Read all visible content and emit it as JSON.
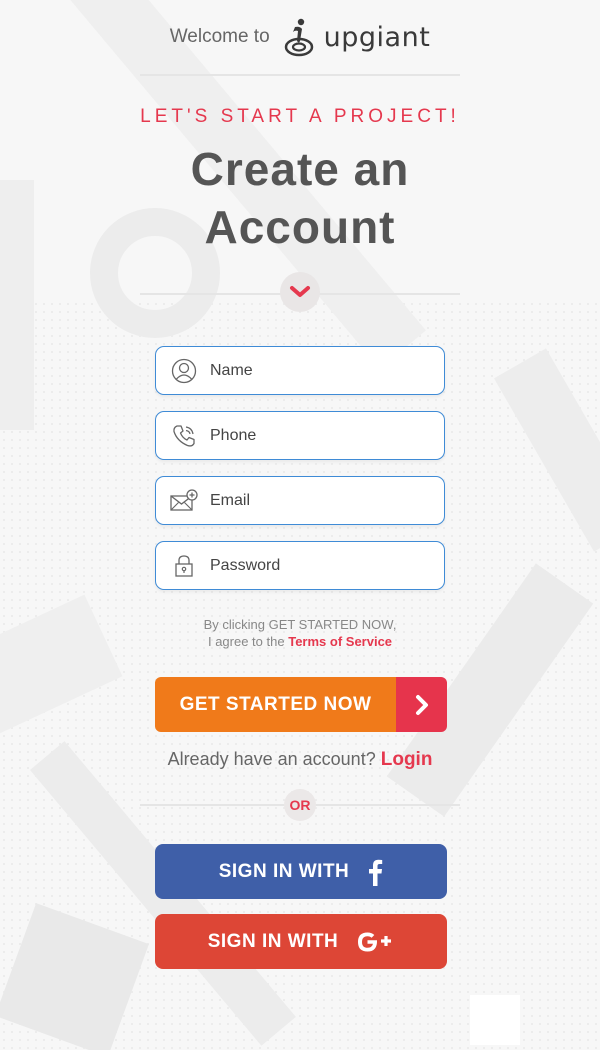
{
  "header": {
    "welcome_text": "Welcome to",
    "logo_text": "upgiant"
  },
  "hero": {
    "kicker": "LET'S START A PROJECT!",
    "title_line1": "Create an",
    "title_line2": "Account"
  },
  "form": {
    "name_placeholder": "Name",
    "phone_placeholder": "Phone",
    "email_placeholder": "Email",
    "password_placeholder": "Password"
  },
  "terms": {
    "line1": "By clicking GET STARTED NOW,",
    "line2": "I agree to the",
    "link": "Terms of Service"
  },
  "cta": {
    "label": "GET STARTED NOW"
  },
  "login": {
    "prompt": "Already have an account?",
    "link": "Login"
  },
  "or_label": "OR",
  "social": {
    "facebook_label": "SIGN IN WITH",
    "google_label": "SIGN IN WITH"
  },
  "colors": {
    "accent_red": "#e5384e",
    "orange": "#f07a1a",
    "input_border": "#3f8bd6",
    "facebook": "#3f5fa8",
    "google": "#dd4636"
  },
  "icons": [
    "logo-icon",
    "chevron-down-icon",
    "user-icon",
    "phone-icon",
    "mail-plus-icon",
    "lock-icon",
    "chevron-right-icon",
    "facebook-icon",
    "google-plus-icon"
  ]
}
